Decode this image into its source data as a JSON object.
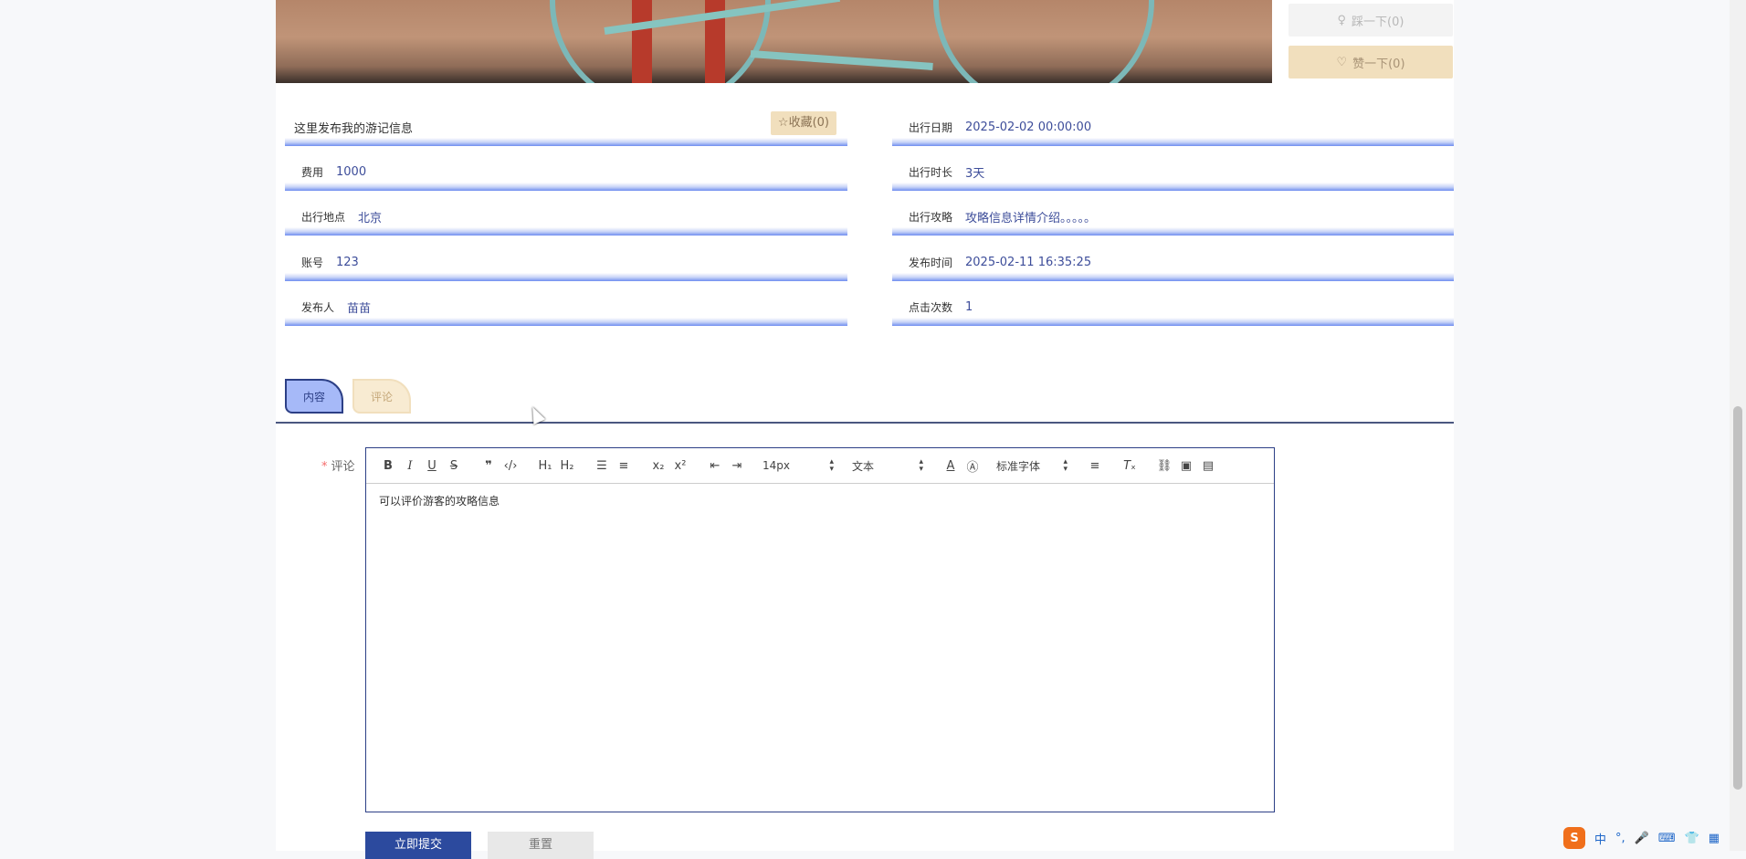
{
  "votes": {
    "down_label": "踩一下(0)",
    "up_label": "赞一下(0)"
  },
  "detail": {
    "title": "这里发布我的游记信息",
    "favorite_label": "☆收藏(0)",
    "fields_left": [
      {
        "label": "费用",
        "value": "1000"
      },
      {
        "label": "出行地点",
        "value": "北京"
      },
      {
        "label": "账号",
        "value": "123"
      },
      {
        "label": "发布人",
        "value": "苗苗"
      }
    ],
    "fields_right": [
      {
        "label": "出行日期",
        "value": "2025-02-02 00:00:00"
      },
      {
        "label": "出行时长",
        "value": "3天"
      },
      {
        "label": "出行攻略",
        "value": "攻略信息详情介绍。。。。。"
      },
      {
        "label": "发布时间",
        "value": "2025-02-11 16:35:25"
      },
      {
        "label": "点击次数",
        "value": "1"
      }
    ]
  },
  "tabs": [
    {
      "label": "内容",
      "active": true
    },
    {
      "label": "评论",
      "active": false
    }
  ],
  "comment_form": {
    "required_mark": "*",
    "label": "评论",
    "font_size_value": "14px",
    "text_style_value": "文本",
    "font_family_value": "标准字体",
    "content": "可以评价游客的攻略信息",
    "submit_label": "立即提交",
    "reset_label": "重置"
  },
  "toolbar_icons": [
    "bold-icon",
    "italic-icon",
    "underline-icon",
    "strike-icon",
    "blockquote-icon",
    "code-icon",
    "h1-icon",
    "h2-icon",
    "ordered-list-icon",
    "bullet-list-icon",
    "subscript-icon",
    "superscript-icon",
    "outdent-icon",
    "indent-icon",
    "font-color-icon",
    "background-color-icon",
    "align-icon",
    "clear-format-icon",
    "link-icon",
    "image-icon",
    "video-icon"
  ],
  "tray": {
    "ime_label": "中",
    "logo_letter": "S"
  },
  "colors": {
    "primary": "#2c3f86",
    "accent_gold": "#f1dfbd",
    "link_value": "#3d4d9a"
  }
}
